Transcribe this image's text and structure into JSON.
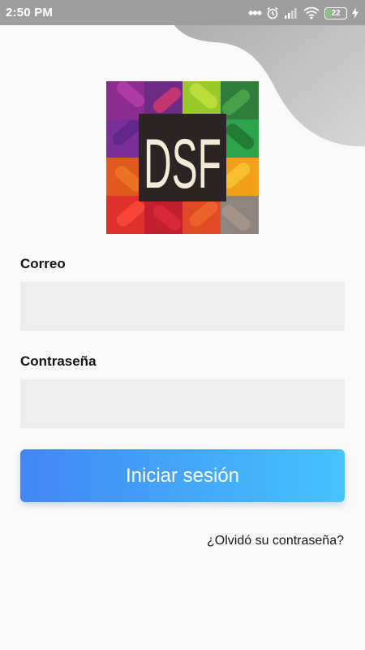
{
  "status_bar": {
    "time": "2:50 PM",
    "icons": [
      "more-dots-icon",
      "alarm-icon",
      "signal-icon",
      "wifi-icon",
      "battery-icon",
      "charging-icon"
    ],
    "battery_level": "22",
    "battery_color": "#7ec77e"
  },
  "logo": {
    "text": "DSF"
  },
  "form": {
    "email_label": "Correo",
    "email_value": "",
    "password_label": "Contraseña",
    "password_value": "",
    "submit_label": "Iniciar sesión",
    "forgot_label": "¿Olvidó su contraseña?"
  },
  "colors": {
    "button_gradient_start": "#4386f5",
    "button_gradient_end": "#45c4fd",
    "field_background": "#eeeeee",
    "status_bar": "#9e9e9e"
  }
}
